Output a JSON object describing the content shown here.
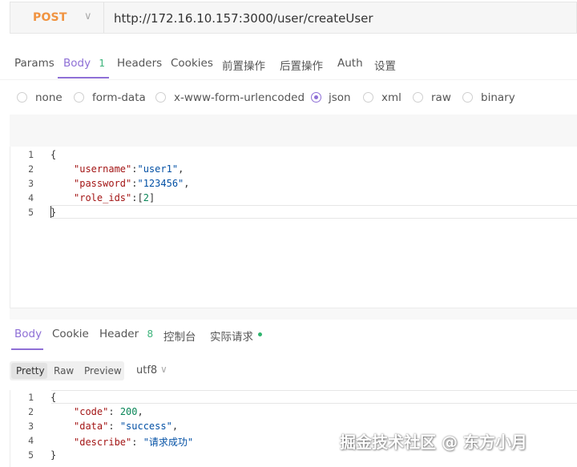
{
  "request": {
    "method": "POST",
    "url": "http://172.16.10.157:3000/user/createUser"
  },
  "request_tabs": [
    {
      "label": "Params"
    },
    {
      "label": "Body",
      "badge": "1",
      "active": true
    },
    {
      "label": "Headers"
    },
    {
      "label": "Cookies"
    },
    {
      "label": "前置操作"
    },
    {
      "label": "后置操作"
    },
    {
      "label": "Auth"
    },
    {
      "label": "设置"
    }
  ],
  "body_types": [
    {
      "label": "none"
    },
    {
      "label": "form-data"
    },
    {
      "label": "x-www-form-urlencoded"
    },
    {
      "label": "json",
      "selected": true
    },
    {
      "label": "xml"
    },
    {
      "label": "raw"
    },
    {
      "label": "binary"
    }
  ],
  "request_body_lines": [
    {
      "num": "1",
      "text": "{"
    },
    {
      "num": "2",
      "key": "\"username\"",
      "sep": ":",
      "value": "\"user1\"",
      "tail": ","
    },
    {
      "num": "3",
      "key": "\"password\"",
      "sep": ":",
      "value": "\"123456\"",
      "tail": ","
    },
    {
      "num": "4",
      "key": "\"role_ids\"",
      "sep": ":[",
      "value": "2",
      "tail": "]"
    },
    {
      "num": "5",
      "text": "}"
    }
  ],
  "response_tabs": [
    {
      "label": "Body",
      "active": true
    },
    {
      "label": "Cookie"
    },
    {
      "label": "Header",
      "badge": "8"
    },
    {
      "label": "控制台"
    },
    {
      "label": "实际请求"
    }
  ],
  "response_view": {
    "modes": [
      "Pretty",
      "Raw",
      "Preview"
    ],
    "selected": "Pretty",
    "encoding": "utf8"
  },
  "response_body_lines": [
    {
      "num": "1",
      "text": "{"
    },
    {
      "num": "2",
      "key": "\"code\"",
      "sep": ": ",
      "value": "200",
      "tail": ","
    },
    {
      "num": "3",
      "key": "\"data\"",
      "sep": ": ",
      "value": "\"success\"",
      "tail": ","
    },
    {
      "num": "4",
      "key": "\"describe\"",
      "sep": ": ",
      "value": "\"请求成功\"",
      "tail": ""
    },
    {
      "num": "5",
      "text": "}"
    }
  ],
  "watermark": "掘金技术社区 @ 东方小月",
  "colors": {
    "accent": "#8e6fd6",
    "method": "#f09340",
    "status_dot": "#2fb46e",
    "badge": "#3bb37a"
  }
}
